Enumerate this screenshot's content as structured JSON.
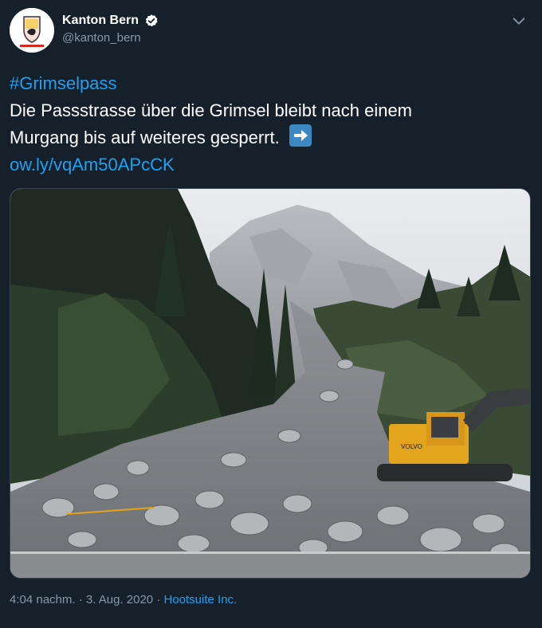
{
  "tweet": {
    "display_name": "Kanton Bern",
    "handle": "@kanton_bern",
    "hashtag": "#Grimselpass",
    "text_line1": "Die Passstrasse über die Grimsel bleibt nach einem",
    "text_line2": "Murgang bis auf weiteres gesperrt.",
    "link": "ow.ly/vqAm50APcCK",
    "time": "4:04 nachm.",
    "separator": " · ",
    "date": "3. Aug. 2020",
    "source": "Hootsuite Inc.",
    "verified_icon": "verified-badge-icon",
    "arrow_icon": "right-arrow-emoji-icon",
    "more_icon": "chevron-down-icon"
  },
  "media": {
    "description_icon": "photo",
    "machine_brand": "VOLVO"
  },
  "colors": {
    "background": "#15202b",
    "link": "#1da1f2",
    "secondary_text": "#8899a6"
  }
}
